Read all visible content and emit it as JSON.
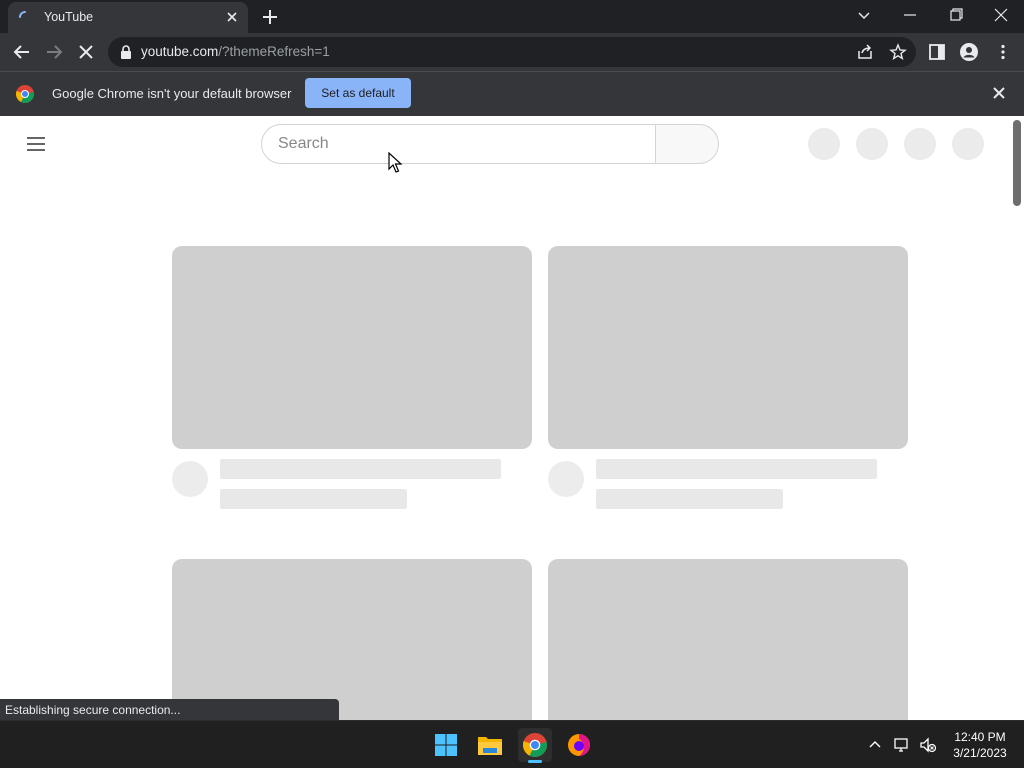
{
  "browser": {
    "tab_title": "YouTube",
    "url_host": "youtube.com",
    "url_path": "/?themeRefresh=1",
    "infobar_message": "Google Chrome isn't your default browser",
    "infobar_button": "Set as default",
    "status_text": "Establishing secure connection..."
  },
  "page": {
    "search_placeholder": "Search"
  },
  "taskbar": {
    "apps": [
      "windows-start",
      "file-explorer",
      "google-chrome",
      "firefox"
    ],
    "time": "12:40 PM",
    "date": "3/21/2023"
  },
  "colors": {
    "chrome_dark": "#202124",
    "chrome_toolbar": "#35363a",
    "accent_button": "#8ab4f8",
    "skeleton": "#cfcfcf"
  }
}
